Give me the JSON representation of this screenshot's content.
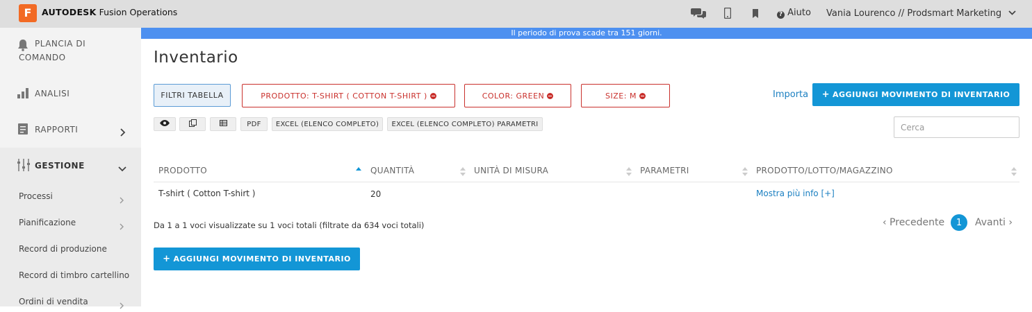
{
  "app": {
    "logo_letter": "F",
    "brand_bold": "AUTODESK",
    "brand_rest": "Fusion Operations",
    "help_label": "Aiuto",
    "user_label": "Vania Lourenco // Prodsmart Marketing"
  },
  "sidebar": {
    "dashboard_line1": "PLANCIA DI",
    "dashboard_line2": "COMANDO",
    "analysis": "ANALISI",
    "reports": "RAPPORTI",
    "management": "GESTIONE",
    "sub_items": [
      "Processi",
      "Pianificazione",
      "Record di produzione",
      "Record di timbro cartellino",
      "Ordini di vendita"
    ]
  },
  "banner": "Il periodo di prova scade tra 151 giorni.",
  "page": {
    "title": "Inventario",
    "filters_button": "FILTRI TABELLA",
    "filter_chips": [
      "PRODOTTO: T-SHIRT ( COTTON T-SHIRT )",
      "COLOR: GREEN",
      "SIZE: M"
    ],
    "import_link": "Importa",
    "add_button_top": "AGGIUNGI MOVIMENTO DI INVENTARIO",
    "add_button_bottom": "AGGIUNGI MOVIMENTO DI INVENTARIO",
    "tools": [
      "PDF",
      "EXCEL (ELENCO COMPLETO)",
      "EXCEL (ELENCO COMPLETO) PARAMETRI"
    ],
    "search_placeholder": "Cerca"
  },
  "table": {
    "headers": [
      "PRODOTTO",
      "QUANTITÀ",
      "UNITÀ DI MISURA",
      "PARAMETRI",
      "PRODOTTO/LOTTO/MAGAZZINO"
    ],
    "rows": [
      {
        "product": "T-shirt ( Cotton T-shirt )",
        "quantity": "20",
        "unit": "",
        "params": "",
        "more": "Mostra più info [+]"
      }
    ],
    "summary": "Da 1 a 1 voci visualizzate su 1 voci totali (filtrate da 634 voci totali)"
  },
  "pagination": {
    "prev": "‹ Precedente",
    "current": "1",
    "next": "Avanti ›"
  },
  "colors": {
    "accent": "#1396d6",
    "danger": "#c9302c",
    "banner": "#4d90f0",
    "brand_orange": "#f26a24"
  }
}
